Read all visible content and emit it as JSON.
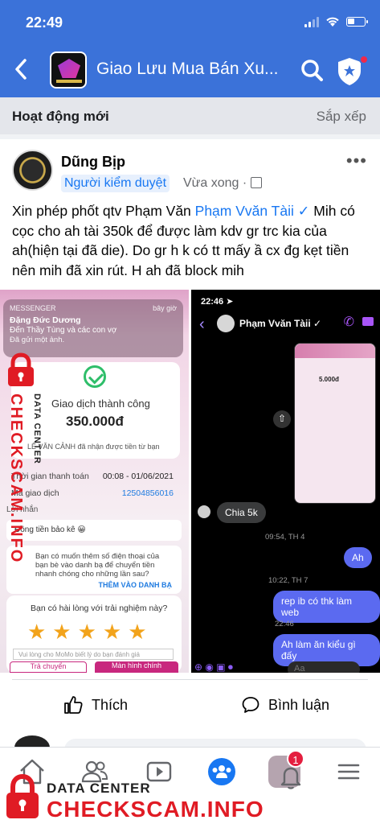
{
  "status": {
    "time": "22:49"
  },
  "header": {
    "title": "Giao Lưu Mua Bán Xu..."
  },
  "section": {
    "title": "Hoạt động mới",
    "sort": "Sắp xếp"
  },
  "post": {
    "author": "Dũng Bịp",
    "badge": "Người kiểm duyệt",
    "time": "Vừa xong ·",
    "text_before": "Xin phép phốt qtv Phạm Văn ",
    "tag": "Phạm Vvăn Tàii ✓",
    "text_after": " Mih có cọc cho ah tài 350k để được làm kdv gr trc kia của ah(hiện tại đã die). Do gr h k có tt mấy ầ cx đg kẹt tiền nên mih đã xin rút. H ah đã block mih"
  },
  "left_shot": {
    "notif_app": "MESSENGER",
    "notif_when": "bây giờ",
    "notif_who": "Đặng Đức Dương",
    "notif_line": "Đến Thầy Tùng và các con vợ",
    "notif_sub": "Đã gửi một ảnh.",
    "status": "Giao dịch thành công",
    "amount": "350.000đ",
    "received": "LÊ VĂN CẢNH đã nhận được tiền từ bạn",
    "time_label": "Thời gian thanh toán",
    "time_value": "00:08 - 01/06/2021",
    "code_label": "Mã giao dịch",
    "code_value": "12504856016",
    "msg_label": "Lời nhắn",
    "msg_value": "Đồng tiền bảo kê 😀",
    "suggest_text": "Bạn có muốn thêm số điện thoại của bạn bè vào danh bạ để chuyển tiền nhanh chóng cho những lần sau?",
    "suggest_cta": "THÊM VÀO DANH BẠ",
    "rate_q": "Bạn có hài lòng với trải nghiệm này?",
    "stars": "★★★★★",
    "rate_placeholder": "Vui lòng cho MoMo biết lý do bạn đánh giá",
    "btn1": "Trả chuyển",
    "btn2": "Màn hình chính"
  },
  "right_shot": {
    "time": "22:46 ➤",
    "name": "Phạm Vvăn Tàii ✓",
    "shot_amount": "5.000đ",
    "msg_in": "Chia 5k",
    "ts1": "09:54, TH 4",
    "msg_out1": "Ah",
    "ts2": "10:22, TH 7",
    "msg_out2": "rep ib có thk làm web",
    "ts3": "22:46",
    "msg_out3": "Ah làm ăn kiểu gì đấy",
    "input_ph": "Aa"
  },
  "actions": {
    "like": "Thích",
    "comment": "Bình luận"
  },
  "tabs": {
    "notif_badge": "1"
  },
  "watermark": {
    "data_center": "DATA CENTER",
    "site": "CHECKSCAM.INFO"
  },
  "colors": {
    "header": "#3b72d9",
    "accent": "#1877f2",
    "badge": "#e41e3f",
    "watermark": "#e01b24"
  }
}
